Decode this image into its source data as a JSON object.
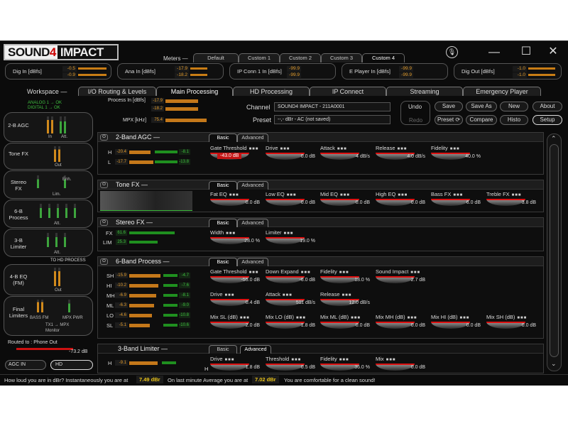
{
  "app": {
    "logo_left": "SOUND",
    "logo_mark": "4",
    "logo_right": "IMPACT",
    "minimize": "—",
    "maximize": "☐",
    "close": "✕"
  },
  "meters": {
    "label": "Meters",
    "tabs": [
      "Default",
      "Custom 1",
      "Custom 2",
      "Custom 3",
      "Custom 4"
    ],
    "active": 4
  },
  "io": [
    {
      "label": "Dig In [dBfs]",
      "v1": "-0.5",
      "v2": "-0.9"
    },
    {
      "label": "Ana In [dBfs]",
      "v1": "-17.9",
      "v2": "-18.2"
    },
    {
      "label": "IP Conn 1 In [dBfs]",
      "v1": "-99.9",
      "v2": "-99.9"
    },
    {
      "label": "E Player In [dBfs]",
      "v1": "-99.9",
      "v2": "-99.9"
    },
    {
      "label": "Dig Out [dBfs]",
      "v1": "-1.0",
      "v2": "-1.0"
    }
  ],
  "workspace": {
    "label": "Workspace",
    "tabs": [
      "I/O Routing & Levels",
      "Main Processing",
      "HD Processing",
      "IP Connect",
      "Streaming",
      "Emergency Player"
    ],
    "active": 1
  },
  "sidebar": {
    "analog": "ANALOG 1 → OK",
    "digital": "DIGITAL 1 → OK",
    "agc": "2-B AGC",
    "agc_in": "In",
    "agc_att": "Att.",
    "tone": "Tone FX",
    "tone_out": "Out",
    "stereo": "Stereo FX",
    "stereo_enh": "Enh.",
    "stereo_lim": "Lim.",
    "proc6": "6-B Process",
    "proc6_att": "Att.",
    "lim3": "3-B Limiter",
    "lim3_att": "Att.",
    "to_hd": "TO HD PROCESS",
    "eq4": "4-B EQ (FM)",
    "eq4_out": "Out",
    "final": "Final Limiters",
    "bass_fm": "BASS FM",
    "mpx_pwr": "MPX PWR",
    "tx1": "TX1 → MPX",
    "tx_ct": "TX1 → MPX",
    "monitor": "Monitor",
    "routed": "Routed to : Phone Out",
    "monitor_val": "-73.2 dB",
    "agc_in_btn": "AGC IN",
    "hd_btn": "HD"
  },
  "header": {
    "process_in": "Process In [dBfs]",
    "pin1": "-17.9",
    "pin2": "-18.2",
    "mpx": "MPX [kHz]",
    "mpx_val": "75.4",
    "channel_label": "Channel",
    "channel_value": "SOUND4 IMPACT - 211A0001",
    "preset_label": "Preset",
    "preset_value": "--,- dBr -  AC (not saved)",
    "undo": "Undo",
    "redo": "Redo",
    "save": "Save",
    "save_as": "Save As",
    "new": "New",
    "about": "About",
    "preset_btn": "Preset",
    "compare": "Compare",
    "histo": "Histo",
    "setup": "Setup"
  },
  "panels": {
    "agc": {
      "title": "2-Band AGC",
      "tabs": [
        "Basic",
        "Advanced"
      ],
      "h_val": "-20.4",
      "l_val": "-17.7",
      "h_gr": "-8.1",
      "l_gr": "-13.8",
      "controls": [
        {
          "label": "Gate Threshold",
          "value": "-43.0 dB"
        },
        {
          "label": "Drive",
          "value": "0.0 dB"
        },
        {
          "label": "Attack",
          "value": "4 dB/s"
        },
        {
          "label": "Release",
          "value": "4.0 dB/s"
        },
        {
          "label": "Fidelity",
          "value": "40.0 %"
        }
      ]
    },
    "tone": {
      "title": "Tone FX",
      "tabs": [
        "Basic",
        "Advanced"
      ],
      "controls": [
        {
          "label": "Fat EQ",
          "value": "0.0 dB"
        },
        {
          "label": "Low EQ",
          "value": "0.0 dB"
        },
        {
          "label": "Mid EQ",
          "value": "0.0 dB"
        },
        {
          "label": "High EQ",
          "value": "0.0 dB"
        },
        {
          "label": "Bass FX",
          "value": "6.0 dB"
        },
        {
          "label": "Treble FX",
          "value": "3.8 dB"
        }
      ]
    },
    "stereo": {
      "title": "Stereo FX",
      "tabs": [
        "Basic",
        "Advanced"
      ],
      "fx_label": "FX",
      "fx_val": "61.6",
      "lim_label": "LIM",
      "lim_val": "25.3",
      "controls": [
        {
          "label": "Width",
          "value": "28.0 %"
        },
        {
          "label": "Limiter",
          "value": "19.0 %"
        }
      ]
    },
    "proc6": {
      "title": "6-Band Process",
      "tabs": [
        "Basic",
        "Advanced"
      ],
      "bands": [
        {
          "n": "SH",
          "v": "-15.9",
          "g": "-4.7"
        },
        {
          "n": "HI",
          "v": "-10.2",
          "g": "-7.6"
        },
        {
          "n": "MH",
          "v": "-6.9",
          "g": "-8.1"
        },
        {
          "n": "ML",
          "v": "-6.3",
          "g": "-9.0"
        },
        {
          "n": "LO",
          "v": "-4.6",
          "g": "-10.8"
        },
        {
          "n": "SL",
          "v": "-5.1",
          "g": "-10.6"
        }
      ],
      "row1": [
        {
          "label": "Gate Threshold",
          "value": "-55.0 dB"
        },
        {
          "label": "Down Expand",
          "value": "-6.0 dB"
        },
        {
          "label": "Fidelity",
          "value": "18.0 %"
        },
        {
          "label": "Sound Impact",
          "value": "2.7 dB"
        }
      ],
      "row2": [
        {
          "label": "Drive",
          "value": "0.4 dB"
        },
        {
          "label": "Attack",
          "value": "511 dB/s"
        },
        {
          "label": "Release",
          "value": "12.0 dB/s"
        }
      ],
      "row3": [
        {
          "label": "Mix SL (dB)",
          "value": "2.0 dB"
        },
        {
          "label": "Mix LO (dB)",
          "value": "1.8 dB"
        },
        {
          "label": "Mix ML (dB)",
          "value": "0.0 dB"
        },
        {
          "label": "Mix MH (dB)",
          "value": "0.0 dB"
        },
        {
          "label": "Mix HI (dB)",
          "value": "0.0 dB"
        },
        {
          "label": "Mix SH (dB)",
          "value": "0.0 dB"
        }
      ]
    },
    "lim3": {
      "title": "3-Band Limiter",
      "tabs": [
        "Basic",
        "Advanced"
      ],
      "h_val": "-9.1",
      "controls": [
        {
          "label": "Drive",
          "value": "1.8 dB"
        },
        {
          "label": "Threshold",
          "value": "0.5 dB"
        },
        {
          "label": "Fidelity",
          "value": "36.0 %"
        },
        {
          "label": "Mix",
          "value": "0.0 dB"
        }
      ]
    }
  },
  "status": {
    "q1": "How loud you are in dBr? Instantaneously you are at",
    "v1": "7.49 dBr",
    "q2": "On last minute Average you are at",
    "v2": "7.02 dBr",
    "q3": "You are comfortable for a clean sound!"
  }
}
